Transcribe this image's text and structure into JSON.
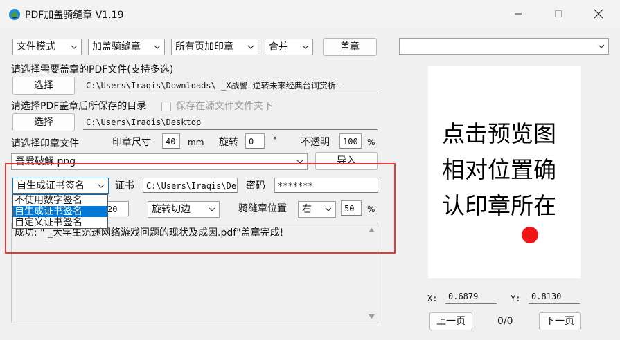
{
  "window": {
    "title": "PDF加盖骑缝章 V1.19"
  },
  "toolbar": {
    "mode": "文件模式",
    "stamp_type": "加盖骑缝章",
    "page_scope": "所有页加印章",
    "merge": "合并",
    "stamp_button": "盖章"
  },
  "pdf_select": {
    "label": "请选择需要盖章的PDF文件(支持多选)",
    "button": "选择",
    "path": "C:\\Users\\Iraqis\\Downloads\\  _X战警-逆转未来经典台词赏析-"
  },
  "output_select": {
    "label": "请选择PDF盖章后所保存的目录",
    "checkbox_label": "保存在源文件文件夹下",
    "button": "选择",
    "path": "C:\\Users\\Iraqis\\Desktop"
  },
  "stamp_file": {
    "label": "请选择印章文件",
    "size_label": "印章尺寸",
    "size_value": "40",
    "size_unit": "mm",
    "rotate_label": "旋转",
    "rotate_value": "0",
    "rotate_unit": "°",
    "opacity_label": "不透明",
    "opacity_value": "100",
    "opacity_unit": "%",
    "file_value": "吾爱破解.png",
    "import_button": "导入"
  },
  "signature": {
    "selected": "自生成证书签名",
    "options": [
      "不使用数字签名",
      "自生成证书签名",
      "自定义证书签名"
    ],
    "cert_label": "证书",
    "cert_path": "C:\\Users\\Iraqis\\De",
    "password_label": "密码",
    "password_value": "*******"
  },
  "seam": {
    "count_value": "20",
    "cut_mode": "旋转切边",
    "position_label": "骑缝章位置",
    "position_value": "右",
    "position_percent": "50",
    "percent_unit": "%"
  },
  "log": {
    "line1": "成功: \"  _大学生沉迷网络游戏问题的现状及成因.pdf\"盖章完成!"
  },
  "preview": {
    "page_combo": "",
    "lines": [
      "点击预览图",
      "相对位置确",
      "认印章所在"
    ],
    "x_label": "X:",
    "x_value": "0.6879",
    "y_label": "Y:",
    "y_value": "0.8130",
    "prev_button": "上一页",
    "page_counter": "0/0",
    "next_button": "下一页"
  },
  "colors": {
    "highlight_box": "#e53935",
    "selection": "#0078d7",
    "stamp_dot": "#f01414"
  }
}
